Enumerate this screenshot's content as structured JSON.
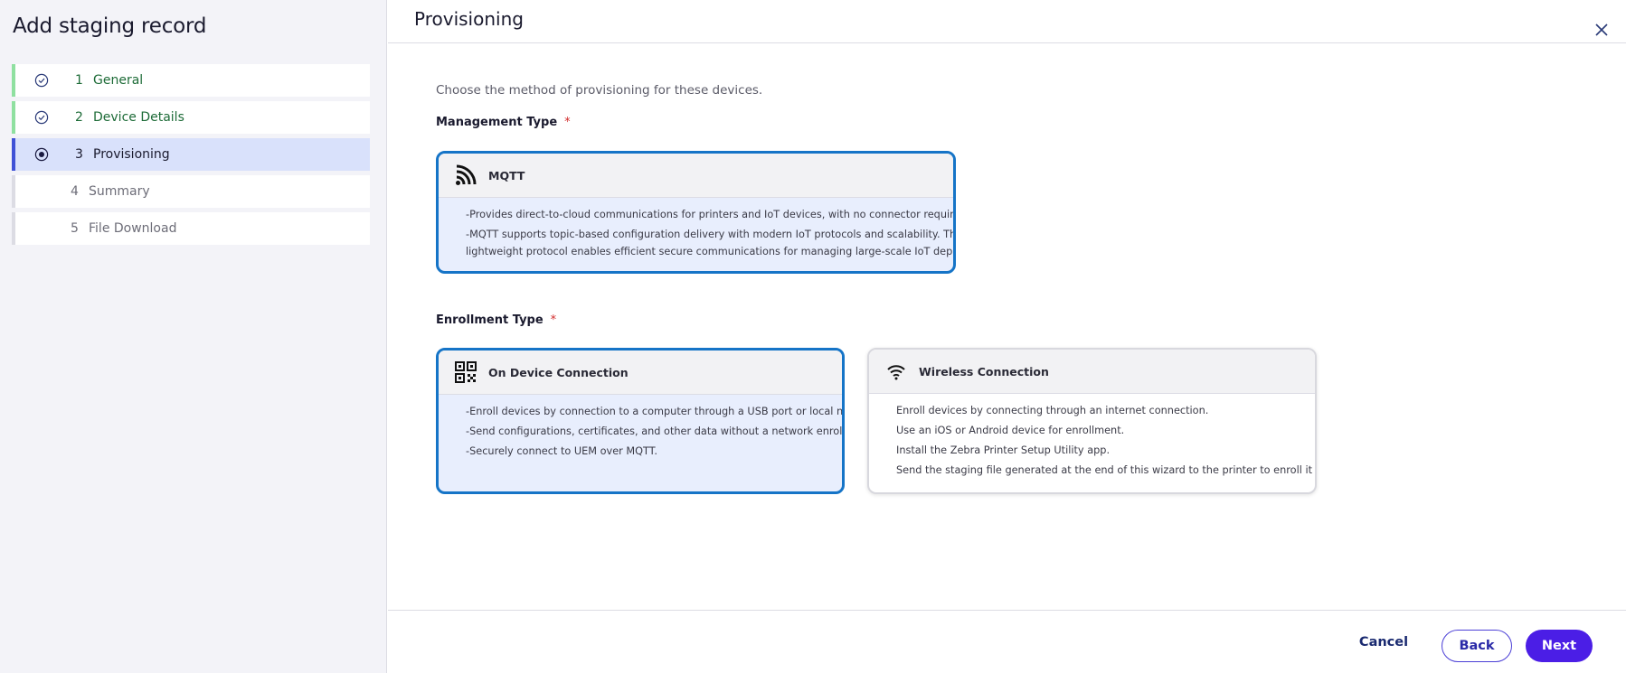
{
  "sidebar": {
    "title": "Add staging record",
    "steps": [
      {
        "num": "1",
        "label": "General",
        "state": "done"
      },
      {
        "num": "2",
        "label": "Device Details",
        "state": "done"
      },
      {
        "num": "3",
        "label": "Provisioning",
        "state": "active"
      },
      {
        "num": "4",
        "label": "Summary",
        "state": "pending"
      },
      {
        "num": "5",
        "label": "File Download",
        "state": "pending"
      }
    ]
  },
  "header": {
    "title": "Provisioning",
    "close_icon": "close-icon"
  },
  "main": {
    "intro": "Choose the method of provisioning for these devices.",
    "management": {
      "label": "Management Type",
      "required_mark": "*",
      "cards": [
        {
          "title": "MQTT",
          "icon": "rss-feed-icon",
          "selected": true,
          "lines": [
            "-Provides direct-to-cloud communications for printers and IoT devices, with no connector required.",
            "-MQTT supports topic-based configuration delivery with modern IoT protocols and scalability. This",
            "lightweight protocol enables efficient secure communications for managing large-scale IoT deployments."
          ]
        }
      ]
    },
    "enrollment": {
      "label": "Enrollment Type",
      "required_mark": "*",
      "cards": [
        {
          "title": "On Device Connection",
          "icon": "qr-code-icon",
          "selected": true,
          "lines": [
            "-Enroll devices by connection to a computer through a USB port or local network.",
            "-Send configurations, certificates, and other data without a network enrollment.",
            "-Securely connect to UEM over MQTT."
          ]
        },
        {
          "title": "Wireless Connection",
          "icon": "wifi-icon",
          "selected": false,
          "lines": [
            "Enroll devices by connecting through an internet connection.",
            "Use an iOS or Android device for enrollment.",
            "Install the Zebra Printer Setup Utility app.",
            "Send the staging file generated at the end of this wizard to the printer to enroll it wirelessly."
          ]
        }
      ]
    }
  },
  "footer": {
    "cancel_label": "Cancel",
    "back_label": "Back",
    "next_label": "Next"
  },
  "colors": {
    "accent": "#4b1ee6",
    "selected_border": "#1574c7",
    "step_done": "#1d6b37",
    "step_active_bg": "#d9e1fb"
  }
}
